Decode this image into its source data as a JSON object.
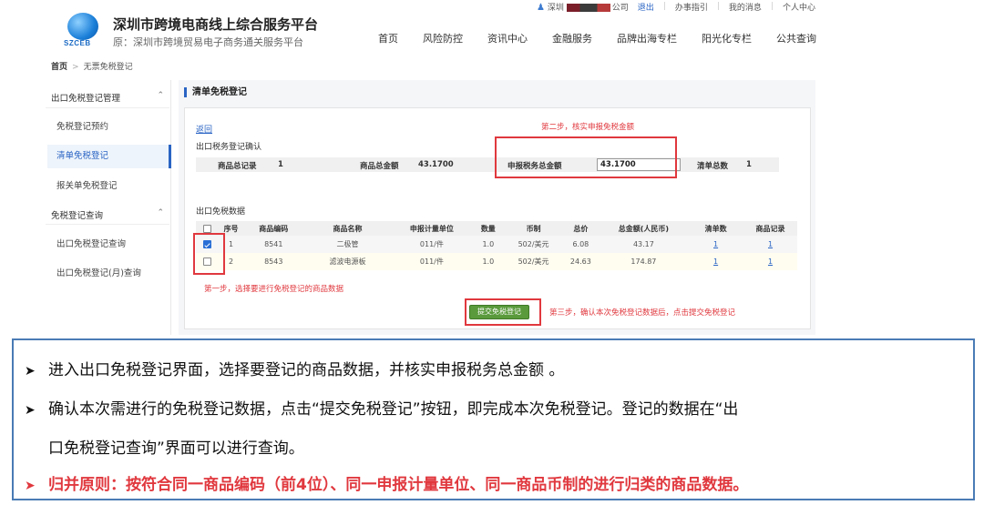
{
  "topbar": {
    "user_city": "深圳",
    "company_suffix": "公司",
    "logout": "退出",
    "guide": "办事指引",
    "messages": "我的消息",
    "personal_center": "个人中心"
  },
  "site": {
    "logo_text": "SZCEB",
    "title": "深圳市跨境电商线上综合服务平台",
    "subtitle": "原：深圳市跨境贸易电子商务通关服务平台"
  },
  "nav": [
    "首页",
    "风险防控",
    "资讯中心",
    "金融服务",
    "品牌出海专栏",
    "阳光化专栏",
    "公共查询"
  ],
  "breadcrumb": {
    "home": "首页",
    "current": "无票免税登记"
  },
  "sidebar": {
    "group1": "出口免税登记管理",
    "group1_items": [
      "免税登记预约",
      "清单免税登记",
      "报关单免税登记"
    ],
    "group2": "免税登记查询",
    "group2_items": [
      "出口免税登记查询",
      "出口免税登记(月)查询"
    ]
  },
  "content": {
    "title": "清单免税登记",
    "back": "返回",
    "confirm_section": "出口税务登记确认",
    "confirm": {
      "total_records_label": "商品总记录",
      "total_records_value": "1",
      "total_amount_label": "商品总金额",
      "total_amount_value": "43.1700",
      "declared_tax_label": "申报税务总金额",
      "declared_tax_value": "43.1700",
      "list_total_label": "清单总数",
      "list_total_value": "1"
    },
    "data_section": "出口免税数据",
    "table": {
      "headers": [
        "序号",
        "商品编码",
        "商品名称",
        "申报计量单位",
        "数量",
        "币制",
        "总价",
        "总金额(人民币)",
        "清单数",
        "商品记录"
      ],
      "rows": [
        {
          "checked": true,
          "seq": "1",
          "code": "8541",
          "name": "二极管",
          "unit": "011/件",
          "qty": "1.0",
          "currency": "502/美元",
          "price": "6.08",
          "rmb": "43.17",
          "lists": "1",
          "records": "1"
        },
        {
          "checked": false,
          "seq": "2",
          "code": "8543",
          "name": "滤波电源板",
          "unit": "011/件",
          "qty": "1.0",
          "currency": "502/美元",
          "price": "24.63",
          "rmb": "174.87",
          "lists": "1",
          "records": "1"
        }
      ]
    },
    "submit": "提交免税登记"
  },
  "annotations": {
    "step1": "第一步，选择要进行免税登记的商品数据",
    "step2": "第二步，核实申报免税金额",
    "step3": "第三步，确认本次免税登记数据后，点击提交免税登记"
  },
  "notes": [
    "进入出口免税登记界面，选择要登记的商品数据，并核实申报税务总金额 。",
    "确认本次需进行的免税登记数据，点击“提交免税登记”按钮，即完成本次免税登记。登记的数据在“出",
    "口免税登记查询”界面可以进行查询。",
    "归并原则：按符合同一商品编码（前4位）、同一申报计量单位、同一商品币制的进行归类的商品数据。"
  ],
  "colors": {
    "accent": "#2a64c4",
    "annotation": "#e0383e",
    "submit": "#5a9a3c",
    "notes_border": "#4a7bb5"
  },
  "icons": {
    "user": "user-icon",
    "chevron": "chevron-up-icon",
    "bullet": "arrow-bullet-icon"
  }
}
